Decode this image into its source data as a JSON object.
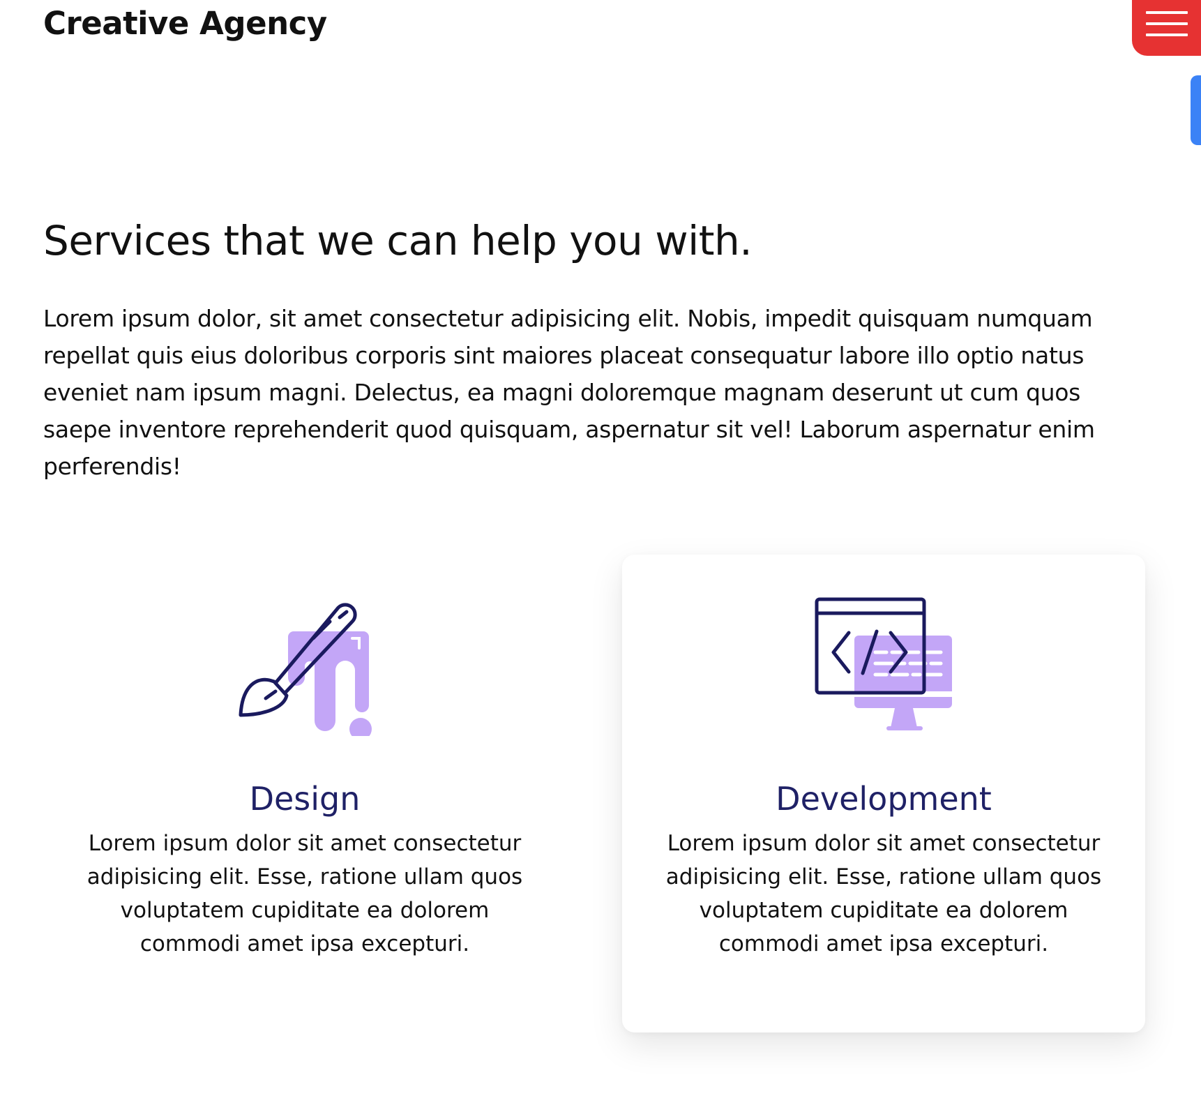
{
  "header": {
    "logo_text": "Creative Agency",
    "menu_icon": "hamburger-menu-icon",
    "menu_color": "#e63232",
    "side_tab_color": "#3b82f6"
  },
  "services": {
    "heading": "Services that we can help you with.",
    "intro": "Lorem ipsum dolor, sit amet consectetur adipisicing elit. Nobis, impedit quisquam numquam repellat quis eius doloribus corporis sint maiores placeat consequatur labore illo optio natus eveniet nam ipsum magni. Delectus, ea magni doloremque magnam deserunt ut cum quos saepe inventore reprehenderit quod quisquam, aspernatur sit vel! Laborum aspernatur enim perferendis!",
    "cards": [
      {
        "icon": "paintbrush-icon",
        "title": "Design",
        "text": "Lorem ipsum dolor sit amet consectetur adipisicing elit. Esse, ratione ullam quos voluptatem cupiditate ea dolorem commodi amet ipsa excepturi."
      },
      {
        "icon": "code-monitor-icon",
        "title": "Development",
        "text": "Lorem ipsum dolor sit amet consectetur adipisicing elit. Esse, ratione ullam quos voluptatem cupiditate ea dolorem commodi amet ipsa excepturi."
      }
    ],
    "title_color": "#1f2166",
    "icon_accent_color": "#c3a6f7"
  }
}
